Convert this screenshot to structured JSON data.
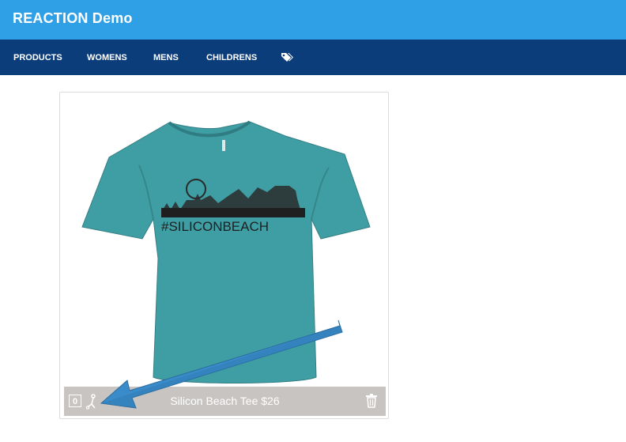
{
  "header": {
    "brand": "REACTION Demo"
  },
  "nav": {
    "items": [
      {
        "label": "PRODUCTS"
      },
      {
        "label": "WOMENS"
      },
      {
        "label": "MENS"
      },
      {
        "label": "CHILDRENS"
      }
    ],
    "tags_icon": "tags-icon"
  },
  "product": {
    "shirt_text": "#SILICONBEACH",
    "quantity": "0",
    "title_price": "Silicon Beach Tee $26",
    "cart_icon": "cart-figure-icon",
    "delete_icon": "trash-icon"
  },
  "colors": {
    "header_bg": "#2fa0e6",
    "nav_bg": "#0b3d7b",
    "shirt": "#3f9ea3",
    "info_bar": "#c8c4c2",
    "annotation_arrow": "#3a8bc9"
  }
}
